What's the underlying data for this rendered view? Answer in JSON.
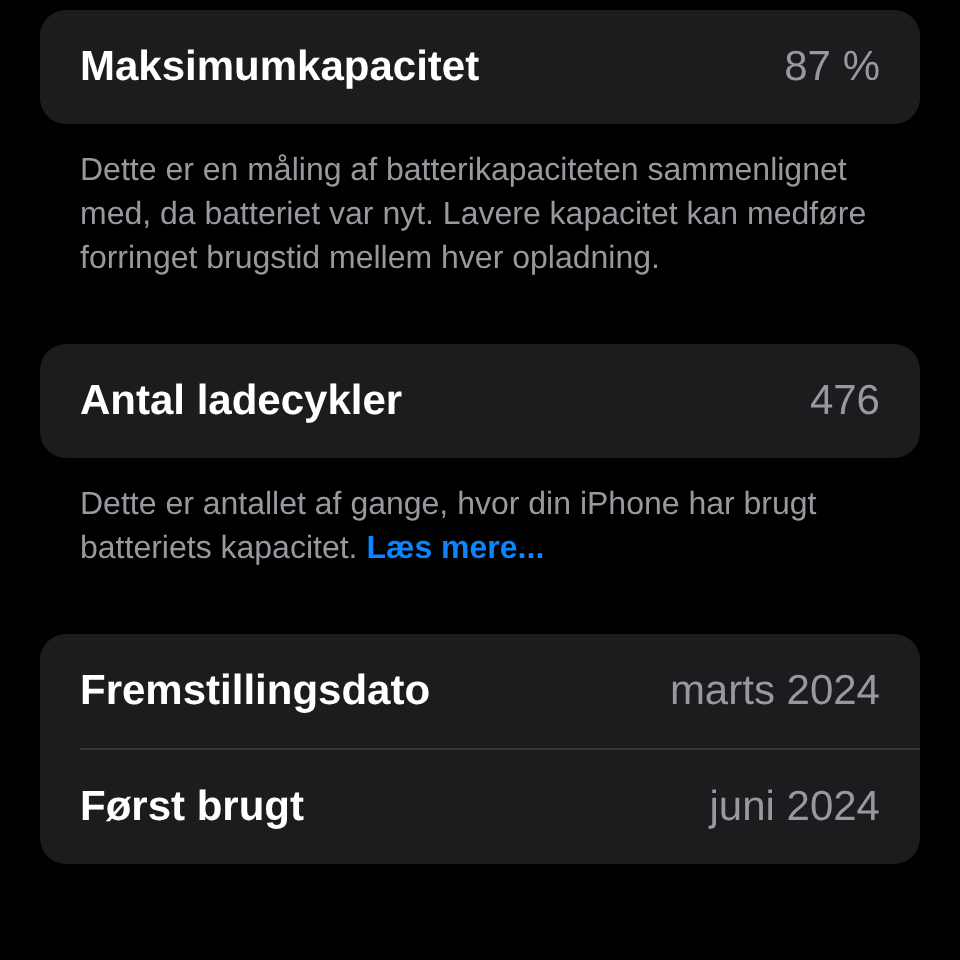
{
  "sections": [
    {
      "rows": [
        {
          "label": "Maksimumkapacitet",
          "value": "87 %"
        }
      ],
      "footer": {
        "text": "Dette er en måling af batterikapaciteten sammenlignet med, da batteriet var nyt. Lavere kapacitet kan medføre forringet brugstid mellem hver opladning."
      }
    },
    {
      "rows": [
        {
          "label": "Antal ladecykler",
          "value": "476"
        }
      ],
      "footer": {
        "text": "Dette er antallet af gange, hvor din iPhone har brugt batteriets kapacitet.",
        "link": "Læs mere..."
      }
    },
    {
      "rows": [
        {
          "label": "Fremstillingsdato",
          "value": "marts 2024"
        },
        {
          "label": "Først brugt",
          "value": "juni 2024"
        }
      ]
    }
  ]
}
